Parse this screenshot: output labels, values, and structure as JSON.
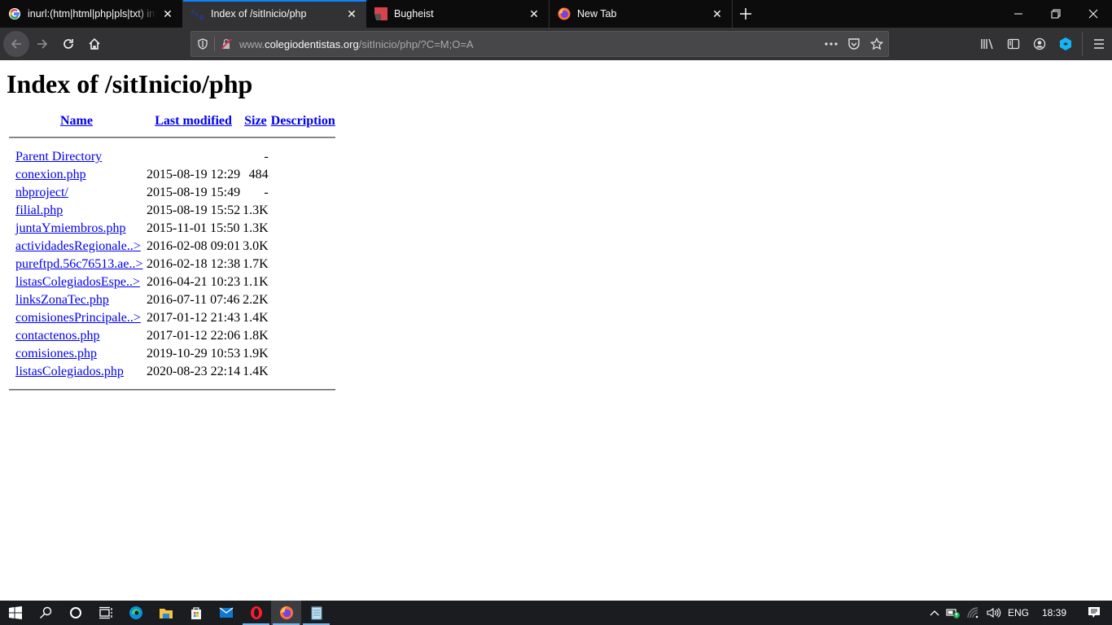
{
  "browser": {
    "tabs": [
      {
        "title": "inurl:(htm|html|php|pls|txt) intitle:index.of",
        "favicon": "google-icon",
        "active": false
      },
      {
        "title": "Index of /sitInicio/php",
        "favicon": "apache-directory-icon",
        "active": true
      },
      {
        "title": "Bugheist",
        "favicon": "bugheist-icon",
        "active": false
      },
      {
        "title": "New Tab",
        "favicon": "firefox-icon",
        "active": false
      }
    ],
    "url": {
      "prefix": "www.",
      "host": "colegiodentistas.org",
      "path": "/sitInicio/php/?C=M;O=A"
    }
  },
  "page": {
    "heading": "Index of /sitInicio/php",
    "columns": [
      "Name",
      "Last modified",
      "Size",
      "Description"
    ],
    "rows": [
      {
        "name": "Parent Directory",
        "modified": "",
        "size": "-",
        "description": ""
      },
      {
        "name": "conexion.php",
        "modified": "2015-08-19 12:29",
        "size": "484",
        "description": ""
      },
      {
        "name": "nbproject/",
        "modified": "2015-08-19 15:49",
        "size": "-",
        "description": ""
      },
      {
        "name": "filial.php",
        "modified": "2015-08-19 15:52",
        "size": "1.3K",
        "description": ""
      },
      {
        "name": "juntaYmiembros.php",
        "modified": "2015-11-01 15:50",
        "size": "1.3K",
        "description": ""
      },
      {
        "name": "actividadesRegionale..>",
        "modified": "2016-02-08 09:01",
        "size": "3.0K",
        "description": ""
      },
      {
        "name": "pureftpd.56c76513.ae..>",
        "modified": "2016-02-18 12:38",
        "size": "1.7K",
        "description": ""
      },
      {
        "name": "listasColegiadosEspe..>",
        "modified": "2016-04-21 10:23",
        "size": "1.1K",
        "description": ""
      },
      {
        "name": "linksZonaTec.php",
        "modified": "2016-07-11 07:46",
        "size": "2.2K",
        "description": ""
      },
      {
        "name": "comisionesPrincipale..>",
        "modified": "2017-01-12 21:43",
        "size": "1.4K",
        "description": ""
      },
      {
        "name": "contactenos.php",
        "modified": "2017-01-12 22:06",
        "size": "1.8K",
        "description": ""
      },
      {
        "name": "comisiones.php",
        "modified": "2019-10-29 10:53",
        "size": "1.9K",
        "description": ""
      },
      {
        "name": "listasColegiados.php",
        "modified": "2020-08-23 22:14",
        "size": "1.4K",
        "description": ""
      }
    ]
  },
  "taskbar": {
    "apps": [
      "start-icon",
      "search-icon",
      "cortana-icon",
      "task-view-icon",
      "edge-icon",
      "file-explorer-icon",
      "store-icon",
      "mail-icon",
      "opera-icon",
      "firefox-icon",
      "notepad-icon"
    ],
    "language": "ENG",
    "time": "18:39"
  },
  "colors": {
    "accent": "#0a84ff",
    "link": "#0000ee"
  }
}
